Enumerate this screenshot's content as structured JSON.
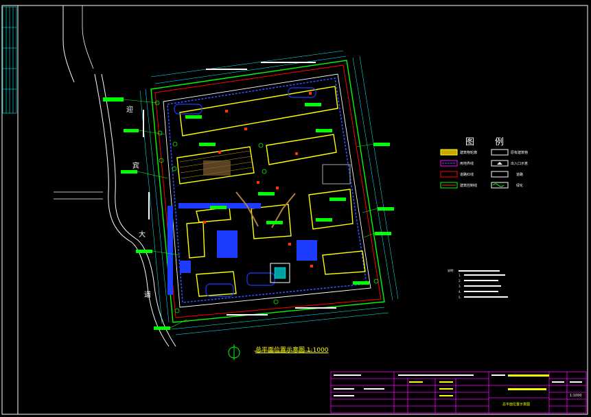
{
  "drawing": {
    "plan_title": "总平面位置示意图 1:1000",
    "road_chars": [
      "迎",
      "宾",
      "大",
      "道"
    ],
    "legend_title": "图例",
    "legend": {
      "left": [
        "建筑物轮廓",
        "用地界线",
        "道路红线",
        "建筑控制线"
      ],
      "right": [
        "原有建筑物",
        "出入口示意",
        "道路",
        "绿化"
      ]
    },
    "notes": {
      "header": "说明：",
      "items": [
        "1.",
        "2.",
        "3.",
        "4.",
        "5."
      ]
    },
    "title_block": {
      "drawing_name": "总平面位置示意图",
      "sheet": "1:1000"
    }
  },
  "colors": {
    "background": "#000000",
    "boundary": "#00ff00",
    "building": "#ffff00",
    "road": "#ffffff",
    "frame": "#ff00ff",
    "annotation": "#00ffff",
    "roadline": "#ff0000",
    "site": "#0000ff"
  }
}
